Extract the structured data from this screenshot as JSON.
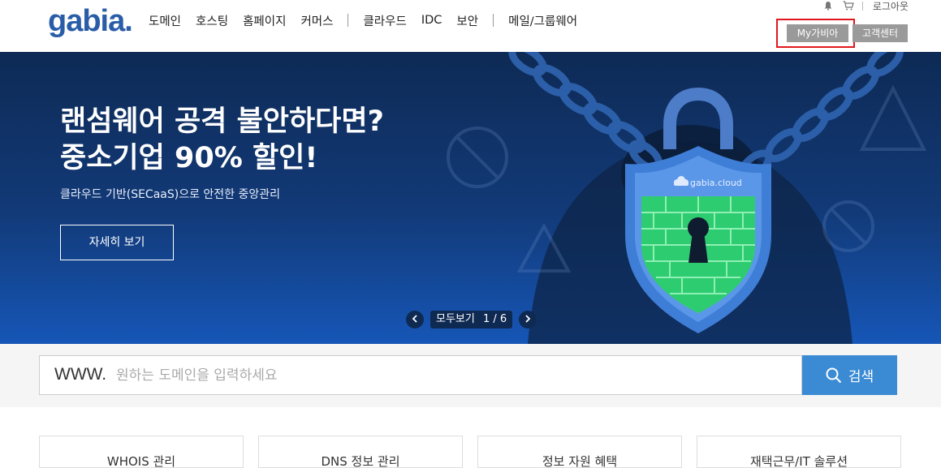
{
  "header": {
    "logo": "gabia.",
    "nav": [
      "도메인",
      "호스팅",
      "홈페이지",
      "커머스",
      "클라우드",
      "IDC",
      "보안",
      "메일/그룹웨어"
    ],
    "util": {
      "logout": "로그아웃"
    },
    "my_button": "My가비아",
    "cs_button": "고객센터"
  },
  "hero": {
    "title_line1": "랜섬웨어 공격 불안하다면?",
    "title_line2": "중소기업 90% 할인!",
    "subtitle": "클라우드 기반(SECaaS)으로 안전한 중앙관리",
    "button": "자세히 보기",
    "shield_text": "gabia.cloud",
    "pager_label": "모두보기",
    "pager_count": "1 / 6"
  },
  "search": {
    "prefix": "WWW.",
    "placeholder": "원하는 도메인을 입력하세요",
    "button": "검색"
  },
  "cards": [
    "WHOIS 관리",
    "DNS 정보 관리",
    "정보 자원 혜택",
    "재택근무/IT 솔루션"
  ],
  "colors": {
    "brand": "#2a5da8",
    "accent": "#3a8bd4",
    "highlight": "#e0181e"
  }
}
